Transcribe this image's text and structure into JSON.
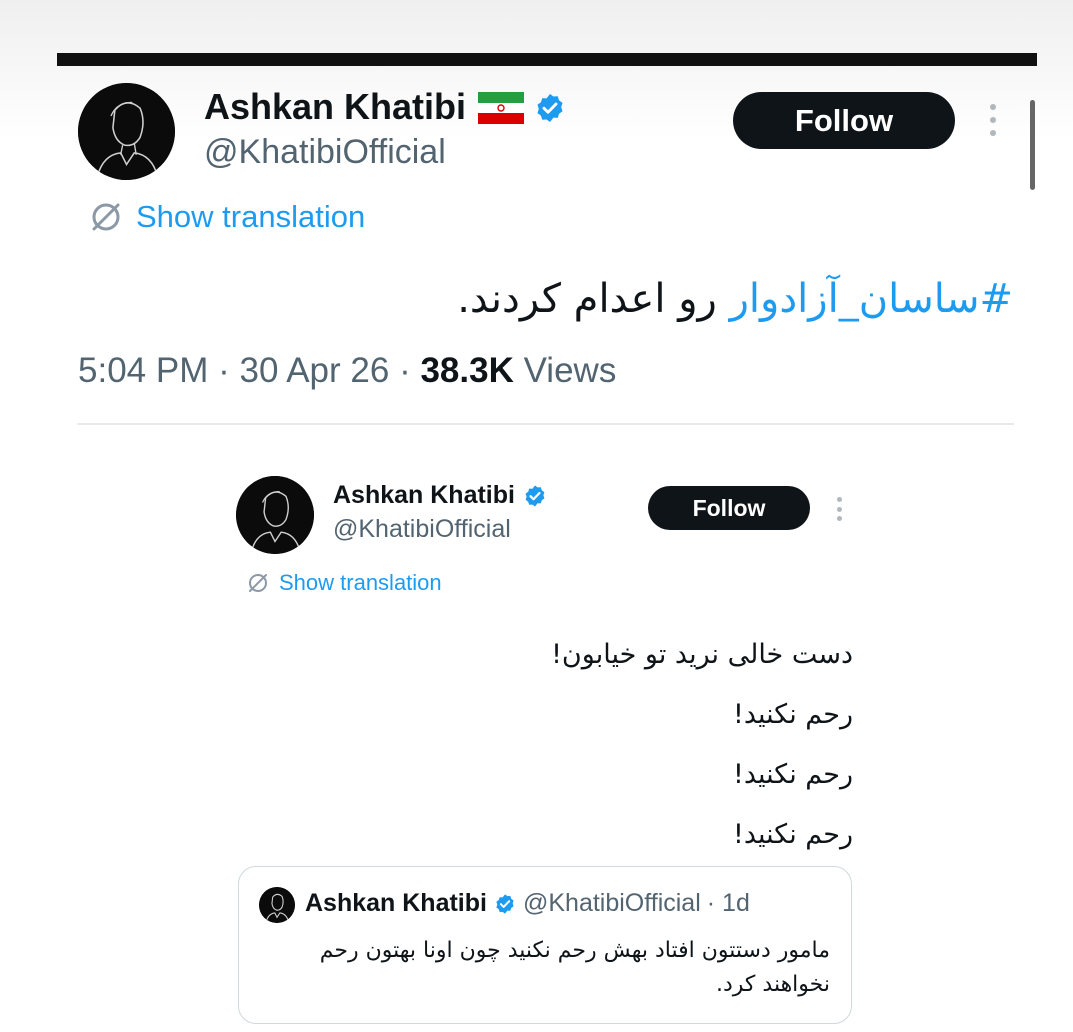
{
  "main_tweet": {
    "author_name": "Ashkan Khatibi",
    "flag_emoji": "🇮🇷",
    "handle": "@KhatibiOfficial",
    "follow_label": "Follow",
    "show_translation_label": "Show translation",
    "hashtag": "#ساسان_آزادوار",
    "text_rest": "رو اعدام کردند.",
    "time": "5:04 PM",
    "date": "30 Apr 26",
    "views_count": "38.3K",
    "views_label": "Views"
  },
  "embedded_tweet": {
    "author_name": "Ashkan Khatibi",
    "handle": "@KhatibiOfficial",
    "follow_label": "Follow",
    "show_translation_label": "Show translation",
    "lines": [
      "دست خالی نرید تو خیابون!",
      "رحم نکنید!",
      "رحم نکنید!",
      "رحم نکنید!"
    ]
  },
  "quoted_tweet": {
    "author_name": "Ashkan Khatibi",
    "handle": "@KhatibiOfficial",
    "age": "· 1d",
    "lines": [
      "مامور دستتون افتاد بهش رحم نکنید چون اونا بهتون رحم",
      "نخواهند کرد."
    ]
  },
  "colors": {
    "accent": "#1d9bf0",
    "verified": "#1d9bf0",
    "text_secondary": "#536471",
    "button_bg": "#0f1419"
  },
  "icons": [
    "verified-badge-icon",
    "translate-globe-icon",
    "more-options-icon",
    "iran-flag-icon"
  ]
}
